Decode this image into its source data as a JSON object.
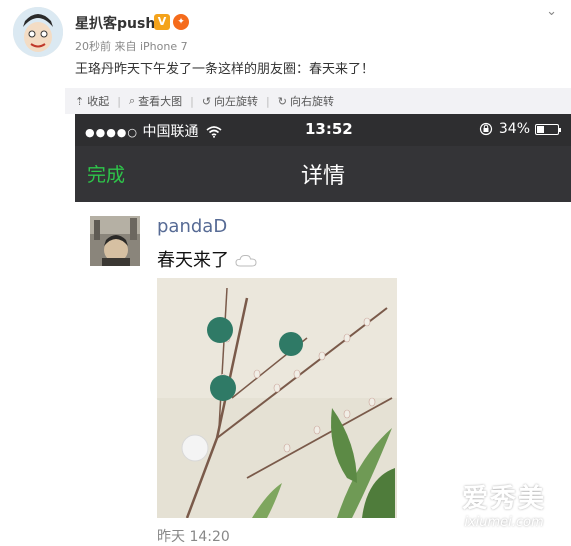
{
  "post": {
    "user_name": "星扒客push",
    "vip_badge": "V",
    "meta": "20秒前 来自 iPhone 7",
    "text": "王珞丹昨天下午发了一条这样的朋友圈：春天来了！"
  },
  "toolbar": {
    "collapse_label": "收起",
    "view_large_label": "查看大图",
    "rotate_left_label": "向左旋转",
    "rotate_right_label": "向右旋转"
  },
  "phone": {
    "status_bar": {
      "carrier": "中国联通",
      "time": "13:52",
      "battery": "34%",
      "battery_level": 0.34
    },
    "nav": {
      "done_label": "完成",
      "title": "详情"
    },
    "moment": {
      "user_name": "pandaD",
      "text": "春天来了",
      "time": "昨天 14:20"
    }
  },
  "watermark": {
    "main": "爱秀美",
    "url": "ixiumei.com"
  },
  "colors": {
    "wechat_green": "#2ec54a",
    "moment_name_blue": "#576b95",
    "status_bar_bg": "#2e2e30"
  },
  "icons": [
    "collapse-icon",
    "zoom-icon",
    "rotate-left-icon",
    "rotate-right-icon",
    "wifi-icon",
    "lock-rotation-icon",
    "battery-icon",
    "more-caret-icon"
  ]
}
